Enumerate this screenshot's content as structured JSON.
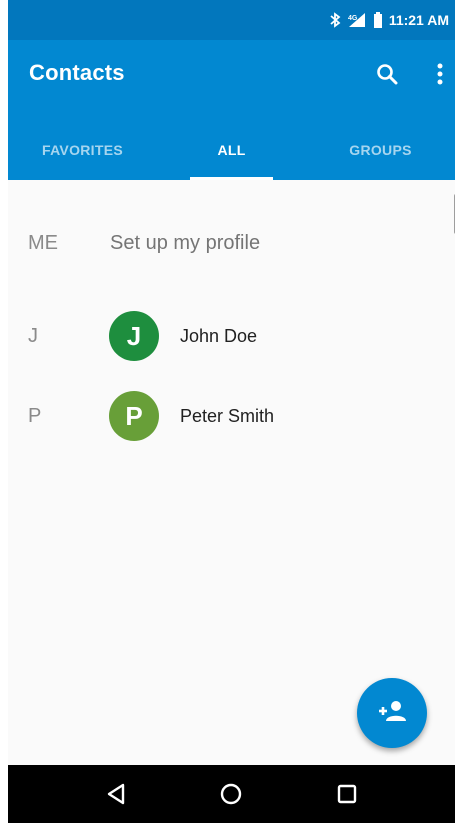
{
  "status_bar": {
    "time": "11:21 AM",
    "icons": [
      "bluetooth-icon",
      "signal-icon",
      "battery-icon"
    ]
  },
  "app_bar": {
    "title": "Contacts",
    "actions": [
      "search-icon",
      "more-vert-icon"
    ]
  },
  "tabs": [
    {
      "label": "FAVORITES",
      "active": false
    },
    {
      "label": "ALL",
      "active": true
    },
    {
      "label": "GROUPS",
      "active": false
    }
  ],
  "me_section": {
    "label": "ME",
    "text": "Set up my profile"
  },
  "contacts": [
    {
      "letter": "J",
      "initial": "J",
      "name": "John Doe",
      "color": "#1e8e3e"
    },
    {
      "letter": "P",
      "initial": "P",
      "name": "Peter Smith",
      "color": "#689f38"
    }
  ],
  "fab": {
    "icon": "add-contact-icon",
    "color": "#0288d1"
  },
  "nav": [
    "back-icon",
    "home-icon",
    "recents-icon"
  ],
  "colors": {
    "primary": "#0288d1",
    "primary_dark": "#0277bd"
  }
}
